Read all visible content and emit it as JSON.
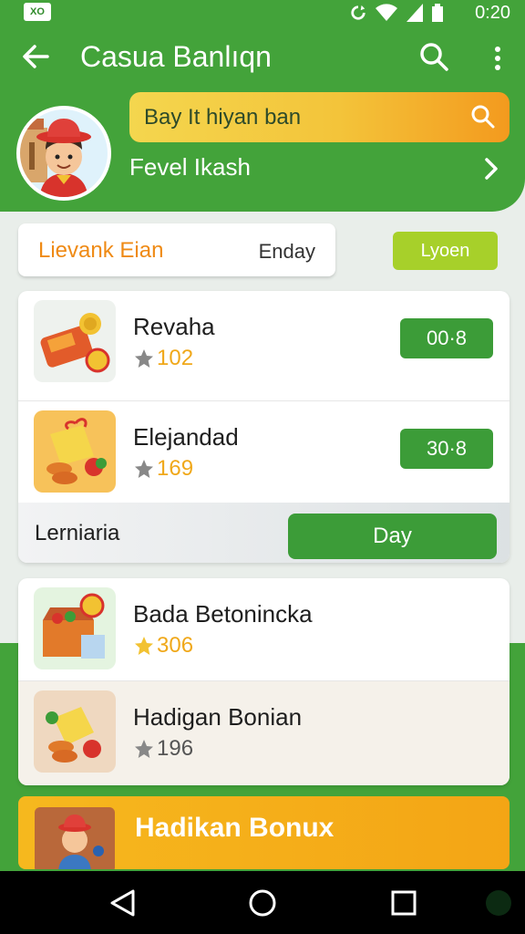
{
  "status_bar": {
    "app_badge": "XO",
    "time": "0:20"
  },
  "app_bar": {
    "title": "Casua Banlıqn"
  },
  "profile": {
    "search_text": "Bay  It hiyan ban",
    "level_label": "Fevel Ikash"
  },
  "segment": {
    "left_label": "Lievank Eian",
    "right_label": "Enday",
    "chip_label": "Lyoen"
  },
  "list": [
    {
      "name": "Revaha",
      "rating": "102",
      "price": "00·8"
    },
    {
      "name": "Elejandad",
      "rating": "169",
      "price": "30·8"
    }
  ],
  "sub_row": {
    "label": "Lerniaria",
    "button": "Day"
  },
  "list2": [
    {
      "name": "Bada Betonincka",
      "rating": "306"
    },
    {
      "name": "Hadigan Bonian",
      "rating": "196"
    }
  ],
  "banner": {
    "title": "Hadikan Bonux"
  },
  "colors": {
    "primary_green": "#43a33a",
    "accent_orange": "#f4a515",
    "lime": "#a7d02a"
  }
}
